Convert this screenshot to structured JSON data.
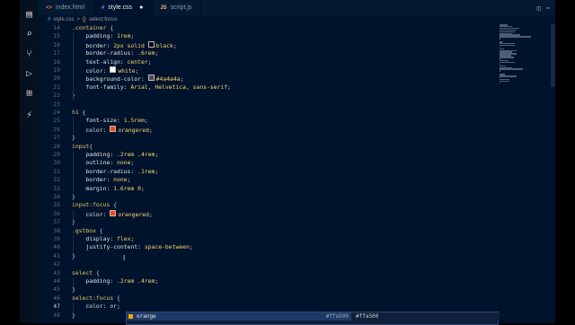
{
  "tabs": [
    {
      "icon": "html-file-icon",
      "glyph": "<>",
      "label": "index.html",
      "active": false,
      "modified": false
    },
    {
      "icon": "css-file-icon",
      "glyph": "#",
      "label": "style.css",
      "active": true,
      "modified": true
    },
    {
      "icon": "js-file-icon",
      "glyph": "JS",
      "label": "script.js",
      "active": false,
      "modified": false
    }
  ],
  "breadcrumb": {
    "file": "style.css",
    "separator": ">",
    "symbol": "select:focus"
  },
  "colors": {
    "accent": "#ffa500",
    "editor_bg": "#00132c",
    "selector": "#e8c56a",
    "value": "#ffd36b"
  },
  "lines": [
    {
      "n": "14",
      "parts": [
        [
          "sel",
          ".container"
        ],
        [
          "punc",
          " {"
        ]
      ]
    },
    {
      "n": "15",
      "parts": [
        [
          "prop",
          "    padding: "
        ],
        [
          "val",
          "1rem"
        ],
        [
          "punc",
          ";"
        ]
      ]
    },
    {
      "n": "16",
      "parts": [
        [
          "prop",
          "    border: "
        ],
        [
          "val",
          "2px solid "
        ],
        [
          "swatch",
          "#000000"
        ],
        [
          "val",
          "black"
        ],
        [
          "punc",
          ";"
        ]
      ]
    },
    {
      "n": "17",
      "parts": [
        [
          "prop",
          "    border-radius: "
        ],
        [
          "val",
          ".6rem"
        ],
        [
          "punc",
          ";"
        ]
      ]
    },
    {
      "n": "18",
      "parts": [
        [
          "prop",
          "    text-align: "
        ],
        [
          "val",
          "center"
        ],
        [
          "punc",
          ";"
        ]
      ]
    },
    {
      "n": "19",
      "parts": [
        [
          "prop",
          "    color: "
        ],
        [
          "swatch",
          "#ffffff"
        ],
        [
          "val",
          "white"
        ],
        [
          "punc",
          ";"
        ]
      ]
    },
    {
      "n": "20",
      "parts": [
        [
          "prop",
          "    background-color: "
        ],
        [
          "swatch",
          "#4a4a4a"
        ],
        [
          "val",
          "#4a4a4a"
        ],
        [
          "punc",
          ";"
        ]
      ]
    },
    {
      "n": "21",
      "parts": [
        [
          "prop",
          "    font-family: "
        ],
        [
          "val",
          "Arial, Helvetica, sans-serif"
        ],
        [
          "punc",
          ";"
        ]
      ]
    },
    {
      "n": "22",
      "parts": [
        [
          "punc",
          "}"
        ]
      ]
    },
    {
      "n": "23",
      "parts": []
    },
    {
      "n": "24",
      "parts": [
        [
          "sel",
          "h1"
        ],
        [
          "punc",
          " {"
        ]
      ]
    },
    {
      "n": "25",
      "parts": [
        [
          "prop",
          "    font-size: "
        ],
        [
          "val",
          "1.5rem"
        ],
        [
          "punc",
          ";"
        ]
      ]
    },
    {
      "n": "26",
      "parts": [
        [
          "prop",
          "    color: "
        ],
        [
          "swatch",
          "#ff4500"
        ],
        [
          "val",
          "orangered"
        ],
        [
          "punc",
          ";"
        ]
      ]
    },
    {
      "n": "27",
      "parts": [
        [
          "punc",
          "}"
        ]
      ]
    },
    {
      "n": "28",
      "parts": [
        [
          "sel",
          "input"
        ],
        [
          "punc",
          "{"
        ]
      ]
    },
    {
      "n": "29",
      "parts": [
        [
          "prop",
          "    padding: "
        ],
        [
          "val",
          ".2rem .4rem"
        ],
        [
          "punc",
          ";"
        ]
      ]
    },
    {
      "n": "30",
      "parts": [
        [
          "prop",
          "    outline: "
        ],
        [
          "val",
          "none"
        ],
        [
          "punc",
          ";"
        ]
      ]
    },
    {
      "n": "31",
      "parts": [
        [
          "prop",
          "    border-radius: "
        ],
        [
          "val",
          ".1rem"
        ],
        [
          "punc",
          ";"
        ]
      ]
    },
    {
      "n": "32",
      "parts": [
        [
          "prop",
          "    border: "
        ],
        [
          "val",
          "none"
        ],
        [
          "punc",
          ";"
        ]
      ]
    },
    {
      "n": "33",
      "parts": [
        [
          "prop",
          "    margin: "
        ],
        [
          "val",
          "1.6rem 0"
        ],
        [
          "punc",
          ";"
        ]
      ]
    },
    {
      "n": "34",
      "parts": [
        [
          "punc",
          "}"
        ]
      ]
    },
    {
      "n": "35",
      "parts": [
        [
          "sel",
          "input:focus"
        ],
        [
          "punc",
          " {"
        ]
      ]
    },
    {
      "n": "36",
      "parts": [
        [
          "prop",
          "    color: "
        ],
        [
          "swatch",
          "#ff4500"
        ],
        [
          "val",
          "orangered"
        ],
        [
          "punc",
          ";"
        ]
      ]
    },
    {
      "n": "37",
      "parts": [
        [
          "punc",
          "}"
        ]
      ]
    },
    {
      "n": "38",
      "parts": [
        [
          "sel",
          ".gstbox"
        ],
        [
          "punc",
          " {"
        ]
      ]
    },
    {
      "n": "39",
      "parts": [
        [
          "prop",
          "    display: "
        ],
        [
          "val",
          "flex"
        ],
        [
          "punc",
          ";"
        ]
      ]
    },
    {
      "n": "40",
      "parts": [
        [
          "prop",
          "    justify-content: "
        ],
        [
          "val",
          "space-between"
        ],
        [
          "punc",
          ";"
        ]
      ]
    },
    {
      "n": "41",
      "parts": [
        [
          "punc",
          "}"
        ]
      ]
    },
    {
      "n": "42",
      "parts": []
    },
    {
      "n": "43",
      "parts": [
        [
          "sel",
          "select"
        ],
        [
          "punc",
          " {"
        ]
      ]
    },
    {
      "n": "44",
      "parts": [
        [
          "prop",
          "    padding: "
        ],
        [
          "val",
          ".2rem .4rem"
        ],
        [
          "punc",
          ";"
        ]
      ]
    },
    {
      "n": "45",
      "parts": [
        [
          "punc",
          "}"
        ]
      ]
    },
    {
      "n": "46",
      "parts": [
        [
          "sel",
          "select:focus"
        ],
        [
          "punc",
          " {"
        ]
      ]
    },
    {
      "n": "47",
      "parts": [
        [
          "prop",
          "    color: "
        ],
        [
          "punc",
          "or;"
        ]
      ]
    },
    {
      "n": "48",
      "parts": [
        [
          "punc",
          "}"
        ]
      ]
    }
  ],
  "current_line": "47",
  "suggestion": {
    "label": "orange",
    "hex_hint": "#ffa500",
    "detail": "#ffa500"
  }
}
